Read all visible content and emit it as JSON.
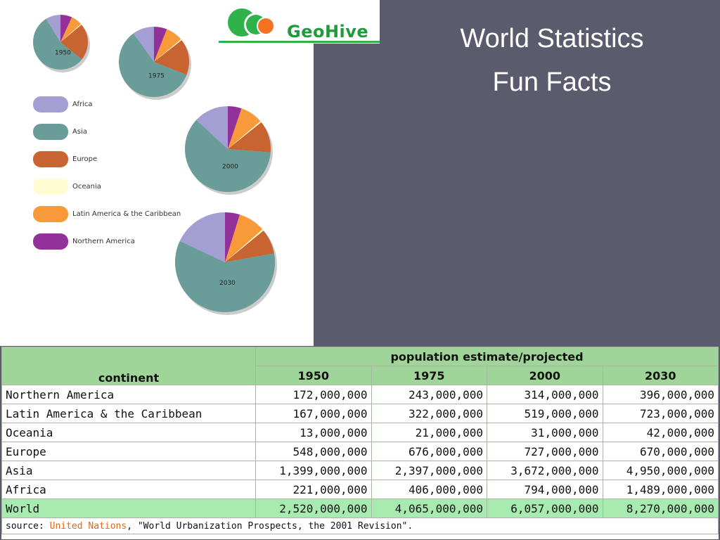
{
  "slide": {
    "title_line1": "World Statistics",
    "title_line2": "Fun Facts",
    "logo_text": "GeoHive"
  },
  "legend": [
    {
      "label": "Africa",
      "color": "#a39fd3"
    },
    {
      "label": "Asia",
      "color": "#6a9c99"
    },
    {
      "label": "Europe",
      "color": "#c86432"
    },
    {
      "label": "Oceania",
      "color": "#fffdd0"
    },
    {
      "label": "Latin America & the Caribbean",
      "color": "#f99a3a"
    },
    {
      "label": "Northern America",
      "color": "#93319a"
    }
  ],
  "chart_data": {
    "type": "pie",
    "categories": [
      "Northern America",
      "Latin America & the Caribbean",
      "Oceania",
      "Europe",
      "Asia",
      "Africa"
    ],
    "series": [
      {
        "name": "1950",
        "values": [
          172000000,
          167000000,
          13000000,
          548000000,
          1399000000,
          221000000
        ]
      },
      {
        "name": "1975",
        "values": [
          243000000,
          322000000,
          21000000,
          676000000,
          2397000000,
          406000000
        ]
      },
      {
        "name": "2000",
        "values": [
          314000000,
          519000000,
          31000000,
          727000000,
          3672000000,
          794000000
        ]
      },
      {
        "name": "2030",
        "values": [
          396000000,
          723000000,
          42000000,
          670000000,
          4950000000,
          1489000000
        ]
      }
    ]
  },
  "table": {
    "header_group": "population estimate/projected",
    "header_first": "continent",
    "years": [
      "1950",
      "1975",
      "2000",
      "2030"
    ],
    "rows": [
      {
        "name": "Northern America",
        "values": [
          "172,000,000",
          "243,000,000",
          "314,000,000",
          "396,000,000"
        ]
      },
      {
        "name": "Latin America & the Caribbean",
        "values": [
          "167,000,000",
          "322,000,000",
          "519,000,000",
          "723,000,000"
        ]
      },
      {
        "name": "Oceania",
        "values": [
          "13,000,000",
          "21,000,000",
          "31,000,000",
          "42,000,000"
        ]
      },
      {
        "name": "Europe",
        "values": [
          "548,000,000",
          "676,000,000",
          "727,000,000",
          "670,000,000"
        ]
      },
      {
        "name": "Asia",
        "values": [
          "1,399,000,000",
          "2,397,000,000",
          "3,672,000,000",
          "4,950,000,000"
        ]
      },
      {
        "name": "Africa",
        "values": [
          "221,000,000",
          "406,000,000",
          "794,000,000",
          "1,489,000,000"
        ]
      }
    ],
    "total": {
      "name": "World",
      "values": [
        "2,520,000,000",
        "4,065,000,000",
        "6,057,000,000",
        "8,270,000,000"
      ]
    },
    "source_prefix": "source: ",
    "source_link": "United Nations",
    "source_suffix": ", \"World Urbanization Prospects, the 2001 Revision\"."
  }
}
